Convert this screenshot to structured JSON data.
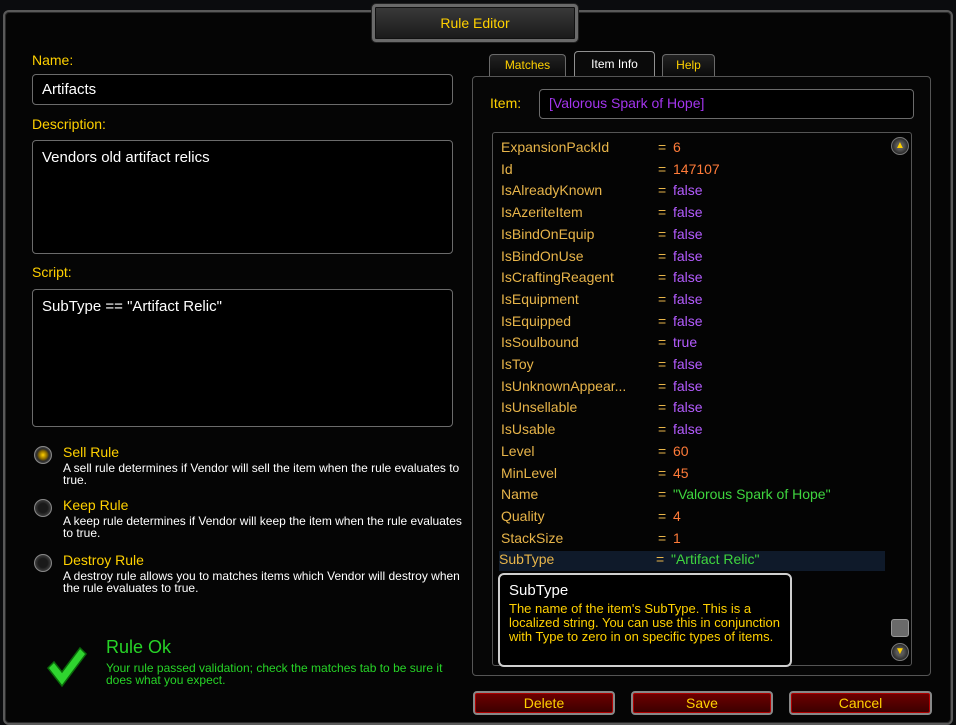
{
  "window": {
    "title": "Rule Editor"
  },
  "form": {
    "name_label": "Name:",
    "name_value": "Artifacts",
    "description_label": "Description:",
    "description_value": "Vendors old artifact relics",
    "script_label": "Script:",
    "script_value": "SubType == \"Artifact Relic\""
  },
  "rule_types": [
    {
      "label": "Sell Rule",
      "desc": "A sell rule determines if Vendor will sell the item when the rule evaluates to true.",
      "selected": true
    },
    {
      "label": "Keep Rule",
      "desc": "A keep rule determines if Vendor will keep the item when the rule evaluates to true.",
      "selected": false
    },
    {
      "label": "Destroy Rule",
      "desc": "A destroy rule allows you to matches items which Vendor will destroy when the rule evaluates to true.",
      "selected": false
    }
  ],
  "status": {
    "title": "Rule Ok",
    "message": "Your rule passed validation; check the matches tab to be sure it does what you expect."
  },
  "tabs": [
    {
      "label": "Matches",
      "active": false
    },
    {
      "label": "Item Info",
      "active": true
    },
    {
      "label": "Help",
      "active": false
    }
  ],
  "item": {
    "label": "Item:",
    "value": "[Valorous Spark of Hope]"
  },
  "properties": [
    {
      "key": "ExpansionPackId",
      "value": "6",
      "type": "number"
    },
    {
      "key": "Id",
      "value": "147107",
      "type": "number"
    },
    {
      "key": "IsAlreadyKnown",
      "value": "false",
      "type": "bool"
    },
    {
      "key": "IsAzeriteItem",
      "value": "false",
      "type": "bool"
    },
    {
      "key": "IsBindOnEquip",
      "value": "false",
      "type": "bool"
    },
    {
      "key": "IsBindOnUse",
      "value": "false",
      "type": "bool"
    },
    {
      "key": "IsCraftingReagent",
      "value": "false",
      "type": "bool"
    },
    {
      "key": "IsEquipment",
      "value": "false",
      "type": "bool"
    },
    {
      "key": "IsEquipped",
      "value": "false",
      "type": "bool"
    },
    {
      "key": "IsSoulbound",
      "value": "true",
      "type": "bool"
    },
    {
      "key": "IsToy",
      "value": "false",
      "type": "bool"
    },
    {
      "key": "IsUnknownAppear...",
      "value": "false",
      "type": "bool"
    },
    {
      "key": "IsUnsellable",
      "value": "false",
      "type": "bool"
    },
    {
      "key": "IsUsable",
      "value": "false",
      "type": "bool"
    },
    {
      "key": "Level",
      "value": "60",
      "type": "number"
    },
    {
      "key": "MinLevel",
      "value": "45",
      "type": "number"
    },
    {
      "key": "Name",
      "value": "\"Valorous Spark of Hope\"",
      "type": "string"
    },
    {
      "key": "Quality",
      "value": "4",
      "type": "number"
    },
    {
      "key": "StackSize",
      "value": "1",
      "type": "number"
    },
    {
      "key": "SubType",
      "value": "\"Artifact Relic\"",
      "type": "string"
    }
  ],
  "tooltip": {
    "title": "SubType",
    "body": "The name of the item's SubType. This is a localized string. You can use this in conjunction with Type to zero in on specific types of items."
  },
  "buttons": {
    "delete": "Delete",
    "save": "Save",
    "cancel": "Cancel"
  },
  "colors": {
    "label": "#ffd100",
    "number": "#ff7b39",
    "bool": "#b45cff",
    "string": "#3fd63f",
    "status": "#27d427"
  }
}
